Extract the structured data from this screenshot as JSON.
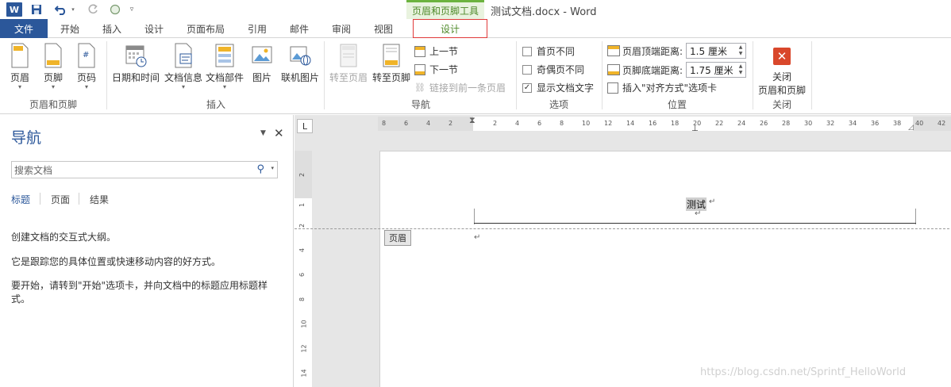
{
  "title_bar": {
    "app_badge": "W",
    "context_tools": "页眉和页脚工具",
    "document_title": "测试文档.docx - Word",
    "icons": [
      "save-icon",
      "undo-icon",
      "redo-icon",
      "touch-mode-icon",
      "customize-qat-icon"
    ]
  },
  "tabs": {
    "file": "文件",
    "home": "开始",
    "insert": "插入",
    "design_main": "设计",
    "layout": "页面布局",
    "references": "引用",
    "mailings": "邮件",
    "review": "审阅",
    "view": "视图",
    "hf_design": "设计"
  },
  "ribbon": {
    "groups": {
      "header_footer": {
        "label": "页眉和页脚",
        "header": "页眉",
        "footer": "页脚",
        "page_number": "页码"
      },
      "insert": {
        "label": "插入",
        "date_time": "日期和时间",
        "doc_info": "文档信息",
        "doc_parts": "文档部件",
        "picture": "图片",
        "online_picture": "联机图片"
      },
      "navigation": {
        "label": "导航",
        "goto_header": "转至页眉",
        "goto_footer": "转至页脚",
        "prev_section": "上一节",
        "next_section": "下一节",
        "link_previous": "链接到前一条页眉"
      },
      "options": {
        "label": "选项",
        "different_first": "首页不同",
        "different_odd_even": "奇偶页不同",
        "show_doc_text": "显示文档文字",
        "show_doc_text_checked": true
      },
      "position": {
        "label": "位置",
        "header_top_label": "页眉顶端距离:",
        "header_top_value": "1.5 厘米",
        "footer_bottom_label": "页脚底端距离:",
        "footer_bottom_value": "1.75 厘米",
        "insert_align_tab": "插入\"对齐方式\"选项卡"
      },
      "close": {
        "label": "关闭",
        "close_line1": "关闭",
        "close_line2": "页眉和页脚"
      }
    }
  },
  "nav_pane": {
    "title": "导航",
    "search_placeholder": "搜索文档",
    "tabs": [
      "标题",
      "页面",
      "结果"
    ],
    "text1": "创建文档的交互式大纲。",
    "text2": "它是跟踪您的具体位置或快速移动内容的好方式。",
    "text3": "要开始，请转到\"开始\"选项卡，并向文档中的标题应用标题样式。"
  },
  "document": {
    "ruler_corner": "L",
    "header_text": "测试",
    "header_tag": "页眉",
    "paragraph_mark": "↵",
    "ruler_h_labels": [
      "8",
      "6",
      "4",
      "2",
      "2",
      "4",
      "6",
      "8",
      "10",
      "12",
      "14",
      "16",
      "18",
      "20",
      "22",
      "24",
      "26",
      "28",
      "30",
      "32",
      "34",
      "36",
      "38",
      "40",
      "42"
    ],
    "ruler_v_labels": [
      "2",
      "1",
      "2",
      "4",
      "6",
      "8",
      "10",
      "12",
      "14"
    ]
  },
  "watermark": "https://blog.csdn.net/Sprintf_HelloWorld",
  "colors": {
    "word_blue": "#2b579a",
    "context_green": "#4f8a2a",
    "close_red": "#d9472b",
    "highlight_red_border": "#e03a3a"
  }
}
